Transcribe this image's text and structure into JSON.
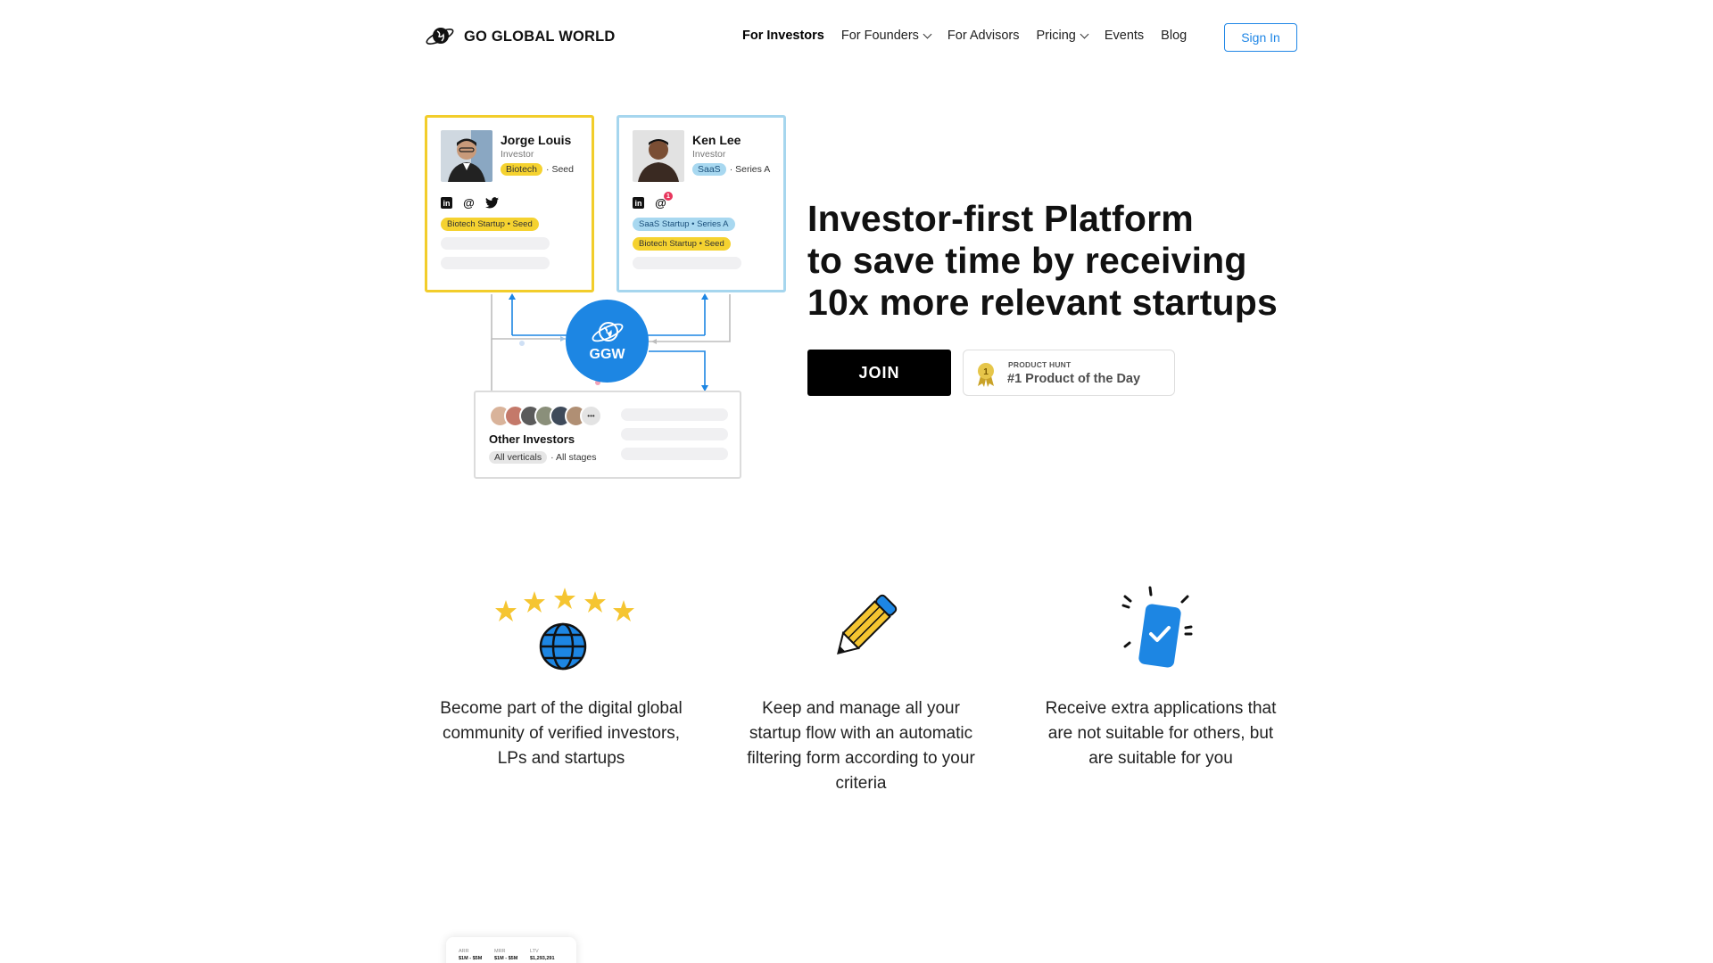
{
  "brand": {
    "name": "GO GLOBAL WORLD"
  },
  "nav": {
    "items": [
      {
        "label": "For Investors",
        "active": true,
        "dropdown": false
      },
      {
        "label": "For Founders",
        "active": false,
        "dropdown": true
      },
      {
        "label": "For Advisors",
        "active": false,
        "dropdown": false
      },
      {
        "label": "Pricing",
        "active": false,
        "dropdown": true
      },
      {
        "label": "Events",
        "active": false,
        "dropdown": false
      },
      {
        "label": "Blog",
        "active": false,
        "dropdown": false
      }
    ],
    "signin_label": "Sign In"
  },
  "diagram": {
    "jorge": {
      "name": "Jorge Louis",
      "role": "Investor",
      "vertical": "Biotech",
      "stage": "· Seed",
      "deals": [
        "Biotech Startup • Seed"
      ]
    },
    "ken": {
      "name": "Ken Lee",
      "role": "Investor",
      "vertical": "SaaS",
      "stage": "· Series A",
      "notification_count": "1",
      "deals": [
        "SaaS Startup • Series A",
        "Biotech Startup • Seed"
      ]
    },
    "hub_label": "GGW",
    "others": {
      "more": "•••",
      "name": "Other Investors",
      "vertical": "All verticals",
      "stage": "· All stages"
    }
  },
  "hero": {
    "title_lines": [
      "Investor-first Platform",
      "to save time by receiving",
      "10x more relevant startups"
    ],
    "join_label": "JOIN",
    "badge_rank": "1",
    "badge_kicker": "PRODUCT HUNT",
    "badge_text": "#1 Product of the Day"
  },
  "features": [
    {
      "icon": "stars-globe-icon",
      "lines": [
        "Become part of the digital global",
        "community of verified investors,",
        "LPs and startups"
      ]
    },
    {
      "icon": "pencil-icon",
      "lines": [
        "Keep and manage all your",
        "startup flow with an automatic",
        "filtering form according to your",
        "criteria"
      ]
    },
    {
      "icon": "phone-check-icon",
      "lines": [
        "Receive extra applications that",
        "are not suitable for others, but",
        "are suitable for you"
      ]
    }
  ],
  "preview": {
    "columns": [
      {
        "label": "ARR",
        "value": "$1M - $5M"
      },
      {
        "label": "MRR",
        "value": "$1M - $5M"
      },
      {
        "label": "LTV",
        "value": "$1,293,291"
      }
    ]
  },
  "colors": {
    "accent_blue": "#1d86e3",
    "yellow": "#f2cd2b",
    "light_blue": "#a6d6ee",
    "black": "#000000"
  }
}
